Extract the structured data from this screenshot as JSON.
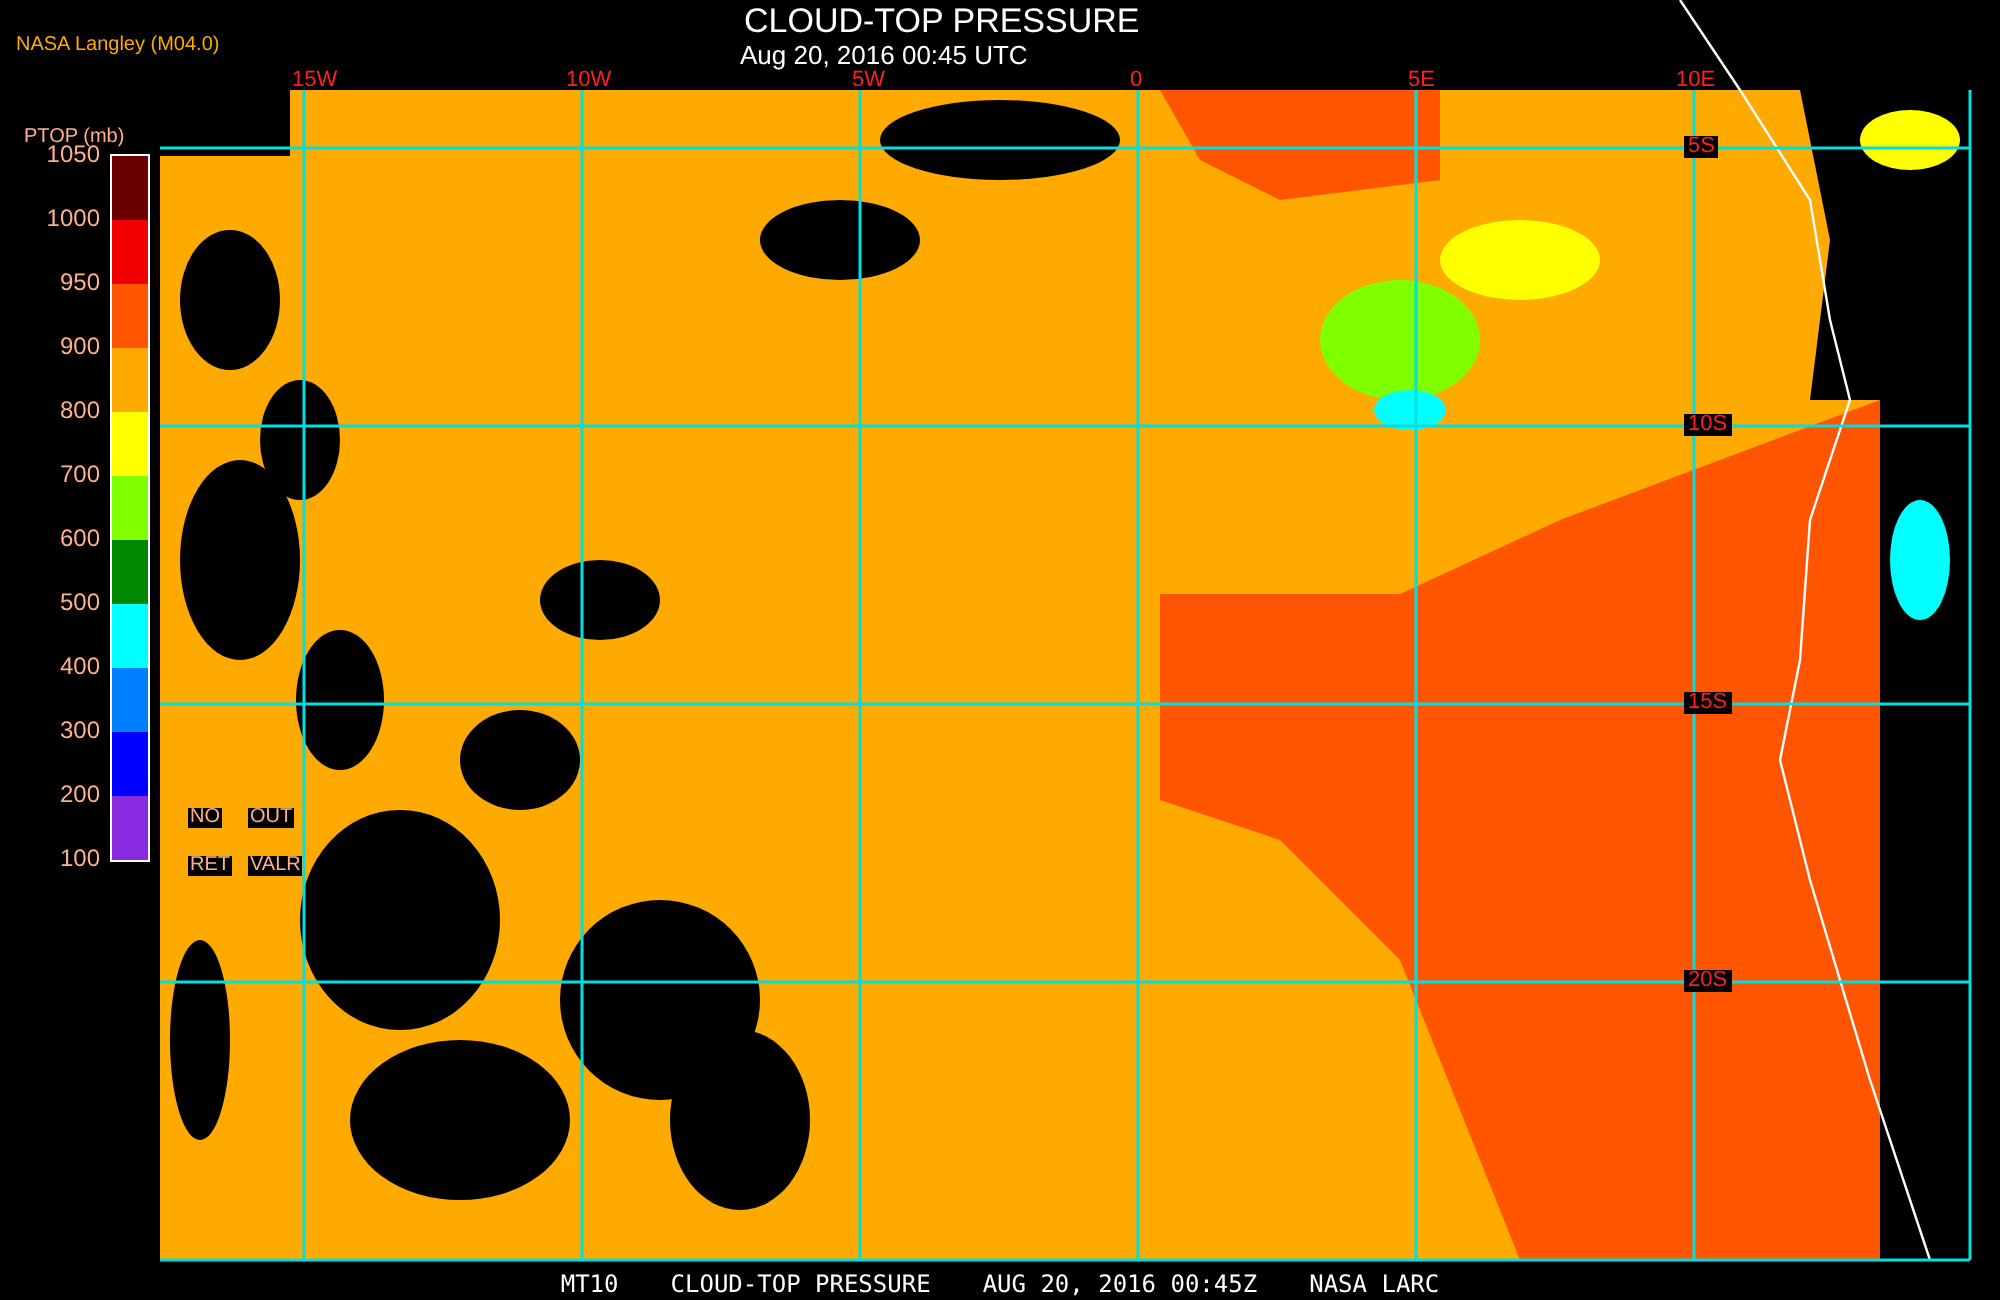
{
  "header": {
    "title": "CLOUD-TOP PRESSURE",
    "subtitle": "Aug 20, 2016 00:45 UTC",
    "credit": "NASA Langley (M04.0)"
  },
  "colorbar": {
    "title": "PTOP (mb)",
    "labels": [
      "1050",
      "1000",
      "950",
      "900",
      "800",
      "700",
      "600",
      "500",
      "400",
      "300",
      "200",
      "100"
    ],
    "bins": [
      {
        "color": "#6b0000"
      },
      {
        "color": "#f00000"
      },
      {
        "color": "#ff5500"
      },
      {
        "color": "#ffaa00"
      },
      {
        "color": "#ffff00"
      },
      {
        "color": "#80ff00"
      },
      {
        "color": "#008800"
      },
      {
        "color": "#00ffff"
      },
      {
        "color": "#0080ff"
      },
      {
        "color": "#0000ff"
      },
      {
        "color": "#8a2be2"
      }
    ]
  },
  "legend_notes": [
    "NO",
    "OUT",
    "RET",
    "VALR"
  ],
  "longitudes": [
    "15W",
    "10W",
    "5W",
    "0",
    "5E",
    "10E"
  ],
  "latitudes": [
    "5S",
    "10S",
    "15S",
    "20S"
  ],
  "footer": [
    "MT10",
    "CLOUD-TOP PRESSURE",
    "AUG 20, 2016 00:45Z",
    "NASA LARC"
  ]
}
